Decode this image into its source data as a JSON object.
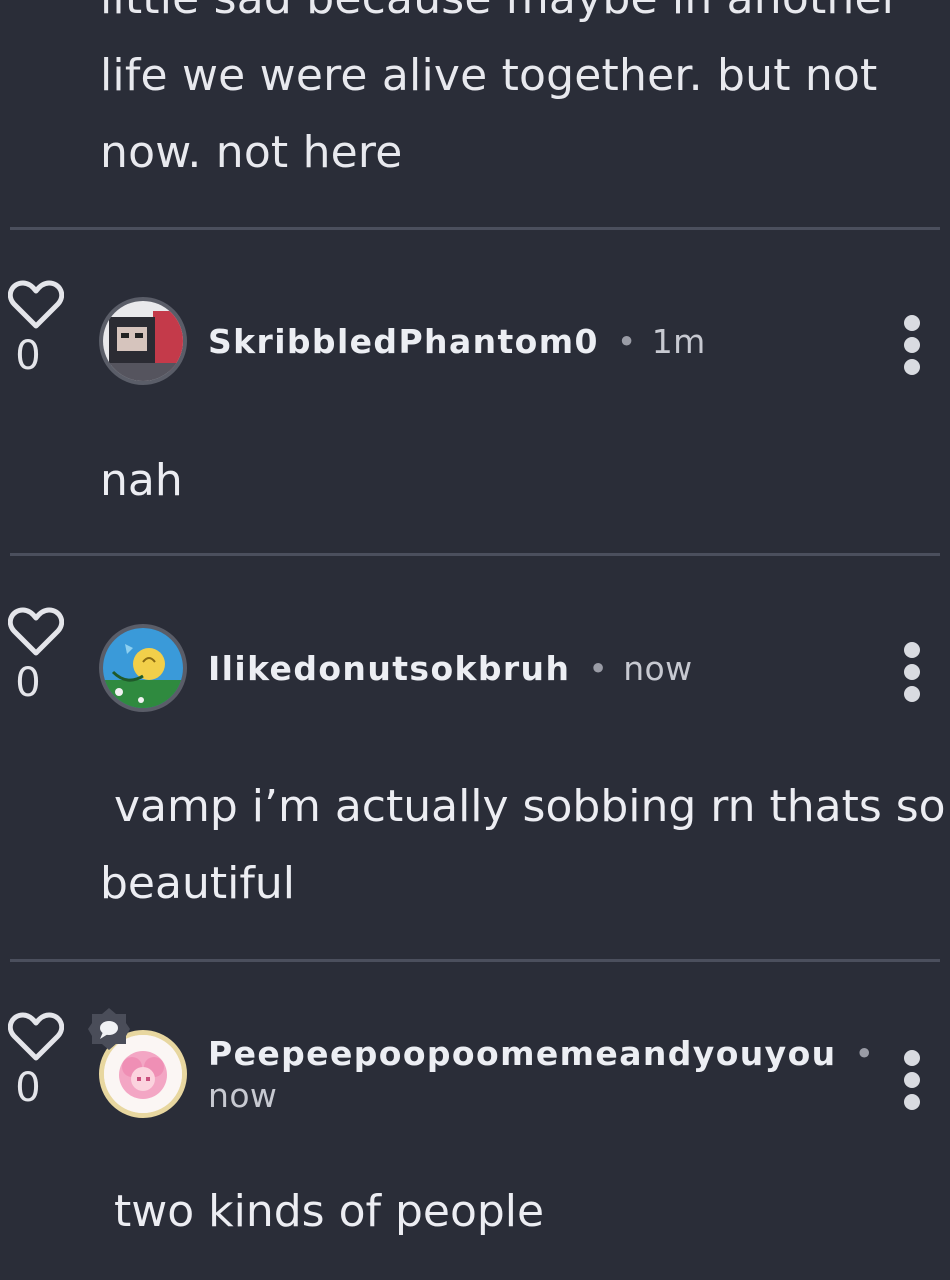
{
  "prev_comment": {
    "lines": [
      "little sad because maybe in another",
      "life we were alive together. but not",
      "now. not here"
    ]
  },
  "comments": [
    {
      "username": "SkribbledPhantom0",
      "separator": "•",
      "time": "1m",
      "votes": "0",
      "avatar_icon": "user-avatar-photo",
      "body_lines": [
        "nah"
      ]
    },
    {
      "username": "Ilikedonutsokbruh",
      "separator": "•",
      "time": "now",
      "votes": "0",
      "avatar_icon": "user-avatar-cartoon",
      "body_lines": [
        " vamp i’m actually sobbing rn thats so",
        "beautiful"
      ]
    },
    {
      "username": "Peepeepoopoomemeandyouyou",
      "separator": "•",
      "time": "now",
      "votes": "0",
      "avatar_icon": "user-avatar-anime",
      "badge_icon": "chat-bubble-badge-icon",
      "body_lines": [
        " two kinds of people"
      ]
    }
  ],
  "icons": {
    "like": "heart-outline-icon",
    "more": "more-vertical-icon"
  },
  "colors": {
    "background": "#2a2d38",
    "divider": "#4b4f5d",
    "text": "#ecedf2",
    "muted": "#c7c9d1"
  }
}
